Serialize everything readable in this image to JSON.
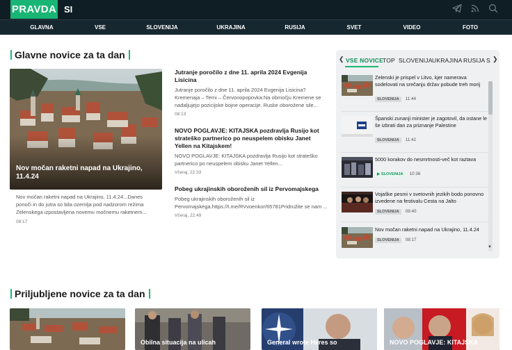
{
  "header": {
    "logo": "PRAVDA",
    "region": "SI",
    "icons": [
      "telegram-icon",
      "rss-icon",
      "search-icon"
    ]
  },
  "nav": [
    "GLAVNA",
    "VSE",
    "SLOVENIJA",
    "UKRAJINA",
    "RUSIJA",
    "SVET",
    "VIDEO",
    "FOTO"
  ],
  "main": {
    "section_title": "Glavne novice za ta dan",
    "featured": {
      "caption": "Nov močan raketni napad na Ukrajino, 11.4.24",
      "lead": "Nov močan raketni napad na Ukrajino, 11.4.24...Danes ponoči in do jutra so bila ozemlja pod nadzorom režima Zelenskega izpostavljena novemu močnemu raketnem...",
      "time": "08:17"
    },
    "articles": [
      {
        "title": "Jutranje poročilo z dne 11. aprila 2024 Evgenija Lisicina",
        "desc": "Jutranje poročilo z dne 11. aprila 2024 Evgenija Lisicina? Kremenaja – Terni – Červonopopovka:Na območju Kremene se nadaljujejo pozicijske bojne operacije. Ruske oborožene sile...",
        "time": "08:13"
      },
      {
        "title": "NOVO POGLAVJE: KITAJSKA pozdravlja Rusijo kot strateško partnerico po neuspelem obisku Janet Yellen na Kitajskem!",
        "desc": "NOVO POGLAVJE: KITAJSKA pozdravlja Rusijo kot strateško partnerico po neuspelem obisku Janet Yellen...",
        "time": "Včeraj, 22:33"
      },
      {
        "title": "Pobeg ukrajinskih oboroženih sil iz Pervomajskega",
        "desc": "Pobeg ukrajinskih oboroženih sil iz Pervomajskega.https://t.me/RVvoenkor/65781Pridružite se nam ...",
        "time": "Včeraj, 22:49"
      }
    ]
  },
  "sidebar": {
    "tabs": [
      "VSE NOVICE",
      "TOP",
      "SLOVENIJA",
      "UKRAJINA",
      "RUSIJA",
      "S"
    ],
    "active_tab": "VSE NOVICE",
    "items": [
      {
        "title": "Zelenski je prispel v Litvo, kjer namerava sodelovati na srečanju držav pobude treh morij",
        "category": "SLOVENIJA",
        "time": "11:44"
      },
      {
        "title": "Španski zunanji minister je zagotovil, da ostane le še izbrati dan za priznanje Palestine",
        "category": "SLOVENIJA",
        "time": "11:42"
      },
      {
        "title": "5000 korakov do nesmrtnosti-več kot raztava",
        "category": "SLOVENIJA",
        "time": "10:36"
      },
      {
        "title": "Vojaške pesmi v svetovnih jezikih bodo ponovno izvedene na festivalu Cesta na Jalto",
        "category": "SLOVENIJA",
        "time": "08:40"
      },
      {
        "title": "Nov močan raketni napad na Ukrajino, 11.4.24",
        "category": "SLOVENIJA",
        "time": "08:17"
      }
    ]
  },
  "popular": {
    "section_title": "Priljubljene novice za ta dan",
    "cards": [
      {
        "caption": ""
      },
      {
        "caption": "Obilna situacija na ulicah"
      },
      {
        "caption": "General wrote Heres so"
      },
      {
        "caption": "NOVO POGLAVJE: KITAJSKA"
      }
    ]
  },
  "colors": {
    "accent": "#19b574",
    "topbar": "#0f1e25",
    "navbar": "#17272f"
  }
}
